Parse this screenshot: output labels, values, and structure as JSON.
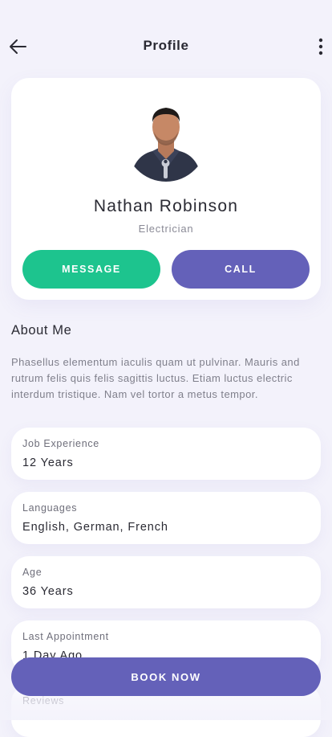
{
  "header": {
    "title": "Profile",
    "back_icon": "arrow-left-icon",
    "menu_icon": "more-vertical-icon"
  },
  "profile": {
    "name": "Nathan Robinson",
    "role": "Electrician",
    "message_label": "MESSAGE",
    "call_label": "CALL"
  },
  "about": {
    "heading": "About Me",
    "text": "Phasellus elementum iaculis quam ut pulvinar. Mauris and rutrum felis quis felis sagittis luctus. Etiam luctus electric interdum tristique. Nam vel tortor a metus tempor."
  },
  "details": [
    {
      "label": "Job Experience",
      "value": "12 Years"
    },
    {
      "label": "Languages",
      "value": "English, German, French"
    },
    {
      "label": "Age",
      "value": "36 Years"
    },
    {
      "label": "Last Appointment",
      "value": "1 Day Ago"
    },
    {
      "label": "Reviews",
      "value": ""
    }
  ],
  "book_label": "BOOK NOW",
  "colors": {
    "primary": "#6461b9",
    "success": "#1dc48e",
    "background": "#f3f2fb"
  }
}
